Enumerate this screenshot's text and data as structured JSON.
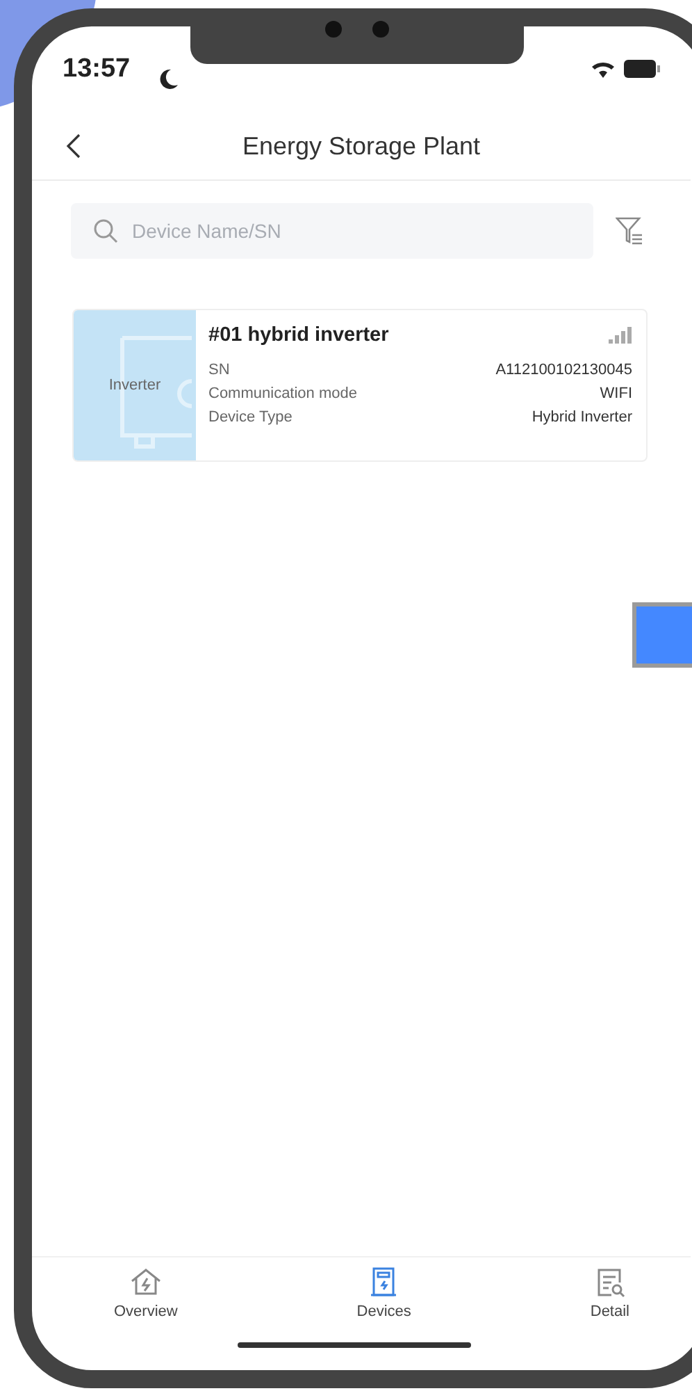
{
  "status_bar": {
    "time": "13:57"
  },
  "header": {
    "title": "Energy Storage Plant"
  },
  "search": {
    "placeholder": "Device Name/SN"
  },
  "devices": [
    {
      "name": "#01 hybrid inverter",
      "image_label": "Inverter",
      "fields": [
        {
          "label": "SN",
          "value": "A112100102130045"
        },
        {
          "label": "Communication mode",
          "value": "WIFI"
        },
        {
          "label": "Device Type",
          "value": "Hybrid Inverter"
        }
      ]
    }
  ],
  "tabs": [
    {
      "label": "Overview",
      "kind": "overview",
      "selected": false
    },
    {
      "label": "Devices",
      "kind": "devices",
      "selected": true
    },
    {
      "label": "Detail",
      "kind": "detail",
      "selected": false
    }
  ]
}
